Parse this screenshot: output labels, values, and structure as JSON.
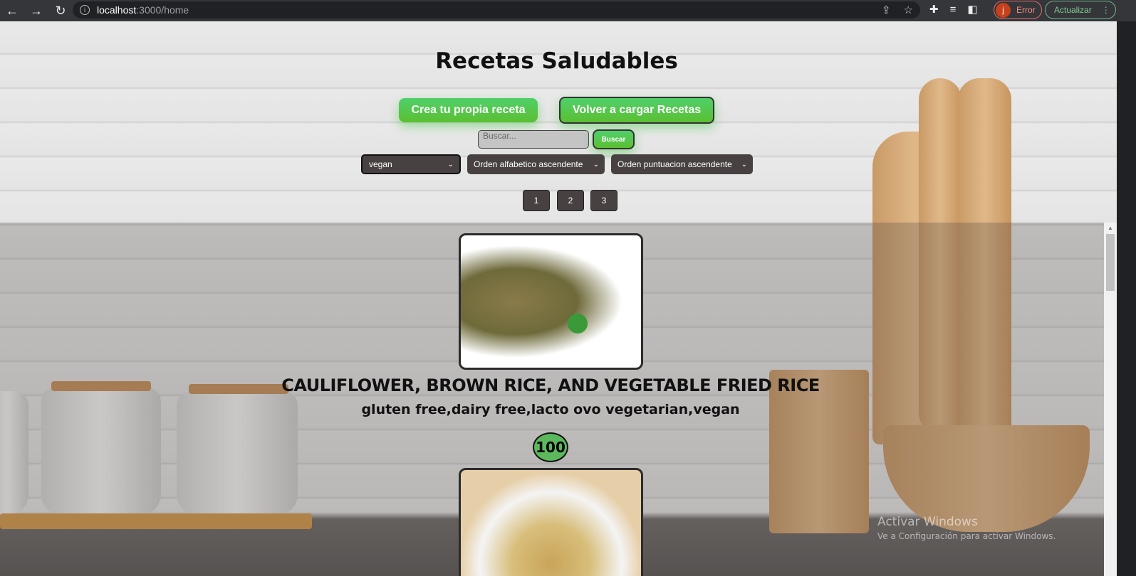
{
  "browser": {
    "url_host": "localhost",
    "url_path": ":3000/home",
    "profile_initial": "j",
    "profile_status": "Error",
    "update_label": "Actualizar"
  },
  "header": {
    "title": "Recetas Saludables",
    "create_button": "Crea tu propia receta",
    "reload_button": "Volver a cargar Recetas"
  },
  "search": {
    "placeholder": "Buscar...",
    "button": "Buscar"
  },
  "filters": {
    "diet": "vegan",
    "alpha_order": "Orden alfabetico ascendente",
    "score_order": "Orden puntuacion ascendente"
  },
  "pagination": [
    "1",
    "2",
    "3"
  ],
  "recipes": [
    {
      "title": "CAULIFLOWER, BROWN RICE, AND VEGETABLE FRIED RICE",
      "diets": "gluten free,dairy free,lacto ovo vegetarian,vegan",
      "score": "100"
    }
  ],
  "watermark": {
    "title": "Activar Windows",
    "subtitle": "Ve a Configuración para activar Windows."
  }
}
